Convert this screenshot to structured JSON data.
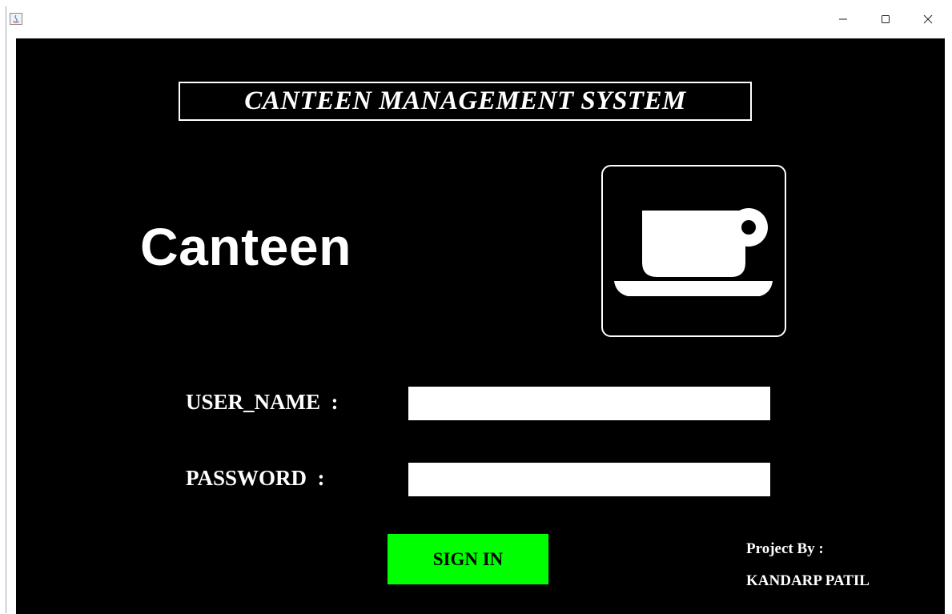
{
  "window": {
    "icon": "java-icon",
    "controls": {
      "minimize": "−",
      "maximize": "☐",
      "close": "✕"
    }
  },
  "app": {
    "title": "CANTEEN MANAGEMENT SYSTEM",
    "logo_text": "Canteen",
    "logo_icon": "coffee-cup-icon"
  },
  "form": {
    "username_label": "USER_NAME  :",
    "username_value": "",
    "password_label": "PASSWORD  :",
    "password_value": "",
    "signin_label": "SIGN IN"
  },
  "credits": {
    "line1": "Project By :",
    "line2": "KANDARP PATIL"
  },
  "colors": {
    "background": "#000000",
    "text": "#ffffff",
    "signin_button": "#00ff00"
  }
}
